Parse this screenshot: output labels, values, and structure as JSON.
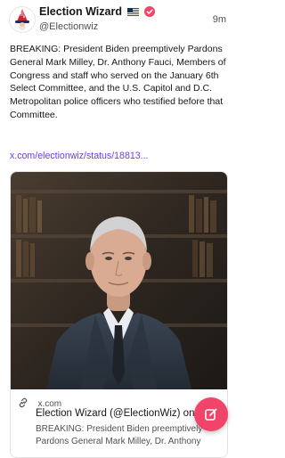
{
  "post": {
    "author": {
      "display_name": "Election Wizard",
      "handle": "@Electionwiz",
      "flag_icon": "us-flag-icon",
      "badge_icon": "verified-badge-icon"
    },
    "timestamp": "9m",
    "text": "BREAKING: President Biden preemptively Pardons General Mark Milley, Dr. Anthony Fauci, Members of Congress and staff who served on the January 6th Select Committee, and the U.S. Capitol and D.C. Metropolitan police officers who testified before that Committee.",
    "link": "x.com/electionwiz/status/18813..."
  },
  "link_card": {
    "domain": "x.com",
    "title": "Election Wizard (@ElectionWiz) on X",
    "description": "BREAKING: President Biden preemptively Pardons General Mark Milley, Dr. Anthony",
    "image": "photo-of-anthony-fauci"
  },
  "fab": {
    "icon": "compose-icon"
  },
  "colors": {
    "accent": "#6a3df0",
    "fab": "#f0446a",
    "verified": "#f0446a"
  }
}
